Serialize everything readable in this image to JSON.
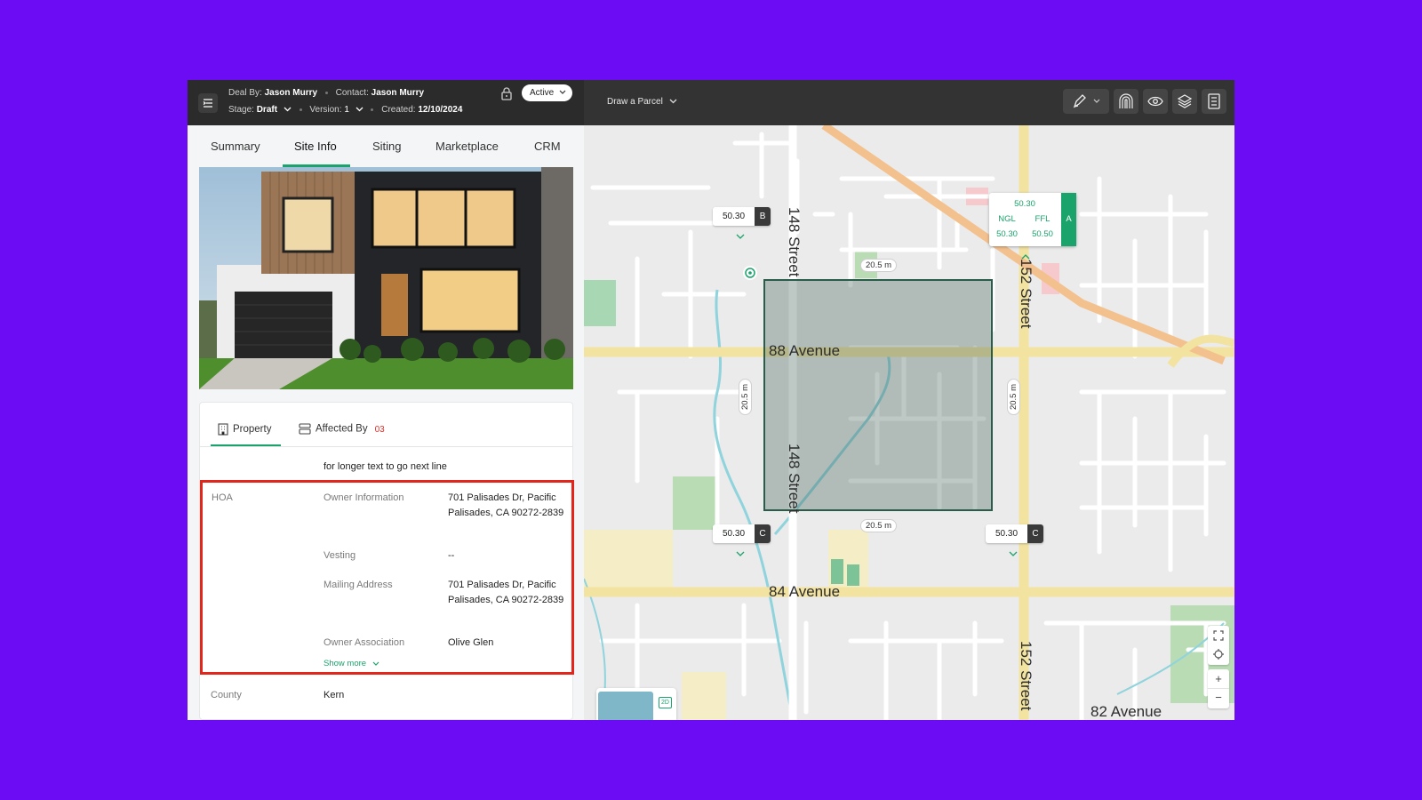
{
  "header": {
    "deal_by_label": "Deal By:",
    "deal_by": "Jason Murry",
    "contact_label": "Contact:",
    "contact": "Jason Murry",
    "stage_label": "Stage:",
    "stage": "Draft",
    "version_label": "Version:",
    "version": "1",
    "created_label": "Created:",
    "created": "12/10/2024",
    "status": "Active"
  },
  "tabs": [
    {
      "label": "Summary"
    },
    {
      "label": "Site Info",
      "active": true
    },
    {
      "label": "Siting"
    },
    {
      "label": "Marketplace"
    },
    {
      "label": "CRM"
    }
  ],
  "subtabs": {
    "property": "Property",
    "affected_by": "Affected By",
    "affected_count": "03"
  },
  "details": {
    "note": "for longer text to go next line",
    "section": "HOA",
    "rows": [
      {
        "label": "Owner Information",
        "value": "701 Palisades Dr,  Pacific Palisades, CA 90272-2839"
      },
      {
        "label": "Vesting",
        "value": "--"
      },
      {
        "label": "Mailing Address",
        "value": "701 Palisades Dr,  Pacific Palisades, CA 90272-2839"
      },
      {
        "label": "Owner Association",
        "value": "Olive Glen"
      }
    ],
    "show_more": "Show more",
    "county_label": "County",
    "county": "Kern"
  },
  "map": {
    "draw_label": "Draw a Parcel",
    "tags": [
      {
        "value": "50.30",
        "key": "B"
      },
      {
        "value": "50.30",
        "key": "C"
      },
      {
        "value": "50.30",
        "key": "C"
      }
    ],
    "tag_a": {
      "value": "50.30",
      "ngl_label": "NGL",
      "ffl_label": "FFL",
      "ngl": "50.30",
      "ffl": "50.50",
      "key": "A"
    },
    "dims": [
      "20.5 m",
      "20.5 m",
      "20.5 m",
      "20.5 m"
    ],
    "streets": {
      "ave88": "88 Avenue",
      "ave84": "84 Avenue",
      "ave82": "82 Avenue",
      "st148a": "148 Street",
      "st148b": "148 Street",
      "st152a": "152 Street",
      "st152b": "152 Street"
    },
    "zoom_in": "+",
    "zoom_out": "−",
    "mini_label": "2D"
  },
  "colors": {
    "accent": "#1aa36b",
    "highlight": "#e2261b",
    "background": "#6c0cf5",
    "header": "#2b2b2b",
    "road": "#f3e3a1"
  },
  "icons": [
    "menu-icon",
    "lock-icon",
    "chevron-down-icon",
    "pen-icon",
    "contour-icon",
    "eye-icon",
    "layers-icon",
    "document-icon",
    "building-icon",
    "stack-icon",
    "expand-icon",
    "locate-icon",
    "target-icon"
  ]
}
